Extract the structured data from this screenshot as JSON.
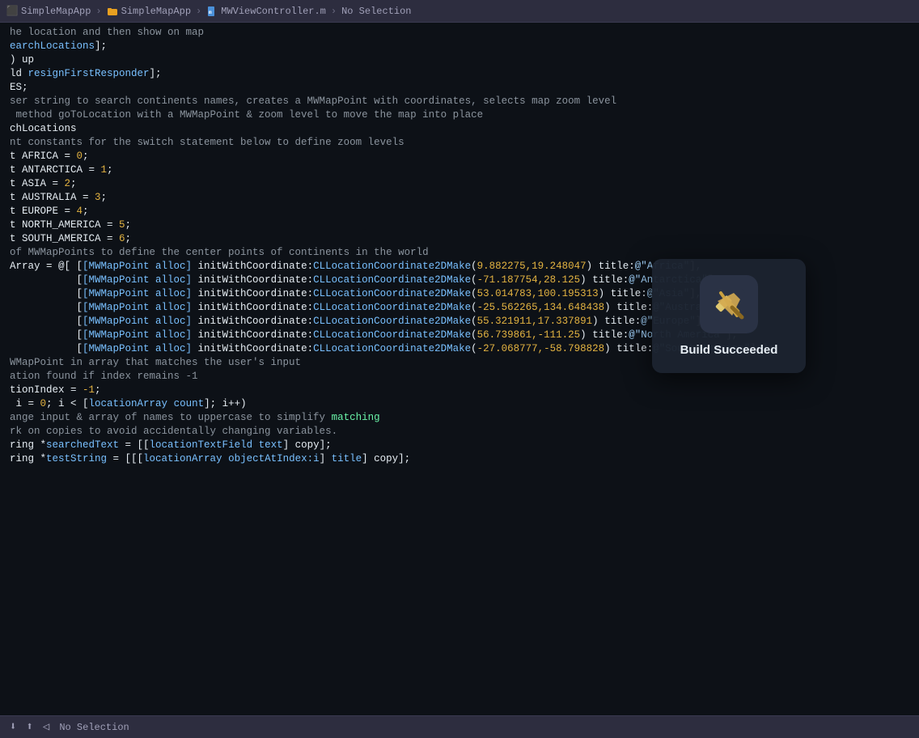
{
  "breadcrumb": {
    "items": [
      {
        "label": "SimpleMapApp",
        "type": "app",
        "icon": "app-icon"
      },
      {
        "label": "SimpleMapApp",
        "type": "folder",
        "icon": "folder-icon"
      },
      {
        "label": "MWViewController.m",
        "type": "file",
        "icon": "file-icon"
      },
      {
        "label": "No Selection",
        "type": "text",
        "icon": null
      }
    ],
    "separator": "›"
  },
  "editor": {
    "lines": [
      {
        "text": "he location and then show on map",
        "class": "c-comment"
      },
      {
        "text": "earchLocations];",
        "class": "c-white"
      },
      {
        "text": "",
        "class": ""
      },
      {
        "text": ") up",
        "class": "c-white"
      },
      {
        "text": "ld resignFirstResponder];",
        "class": "c-white"
      },
      {
        "text": "ES;",
        "class": "c-white"
      },
      {
        "text": "",
        "class": ""
      },
      {
        "text": "ser string to search continents names, creates a MWMapPoint with coordinates, selects map zoom level",
        "class": "c-comment"
      },
      {
        "text": " method goToLocation with a MWMapPoint & zoom level to move the map into place",
        "class": "c-comment"
      },
      {
        "text": "chLocations",
        "class": "c-white"
      },
      {
        "text": "",
        "class": ""
      },
      {
        "text": "nt constants for the switch statement below to define zoom levels",
        "class": "c-comment"
      },
      {
        "text": "t AFRICA = 0;",
        "class": ""
      },
      {
        "text": "t ANTARCTICA = 1;",
        "class": ""
      },
      {
        "text": "t ASIA = 2;",
        "class": ""
      },
      {
        "text": "t AUSTRALIA = 3;",
        "class": ""
      },
      {
        "text": "t EUROPE = 4;",
        "class": ""
      },
      {
        "text": "t NORTH_AMERICA = 5;",
        "class": ""
      },
      {
        "text": "t SOUTH_AMERICA = 6;",
        "class": ""
      },
      {
        "text": "",
        "class": ""
      },
      {
        "text": "of MWMapPoints to define the center points of continents in the world",
        "class": "c-comment"
      },
      {
        "text": "Array = @[ [[MWMapPoint alloc] initWithCoordinate:CLLocationCoordinate2DMake(9.882275,19.248047) title:@\"Africa\"],",
        "class": ""
      },
      {
        "text": "           [[MWMapPoint alloc] initWithCoordinate:CLLocationCoordinate2DMake(-71.187754,28.125) title:@\"Antarctica\"],",
        "class": ""
      },
      {
        "text": "           [[MWMapPoint alloc] initWithCoordinate:CLLocationCoordinate2DMake(53.014783,100.195313) title:@\"Asia\"],",
        "class": ""
      },
      {
        "text": "           [[MWMapPoint alloc] initWithCoordinate:CLLocationCoordinate2DMake(-25.562265,134.648438) title:@\"Australia\"],",
        "class": ""
      },
      {
        "text": "           [[MWMapPoint alloc] initWithCoordinate:CLLocationCoordinate2DMake(55.321911,17.337891) title:@\"Europe\"],",
        "class": ""
      },
      {
        "text": "           [[MWMapPoint alloc] initWithCoordinate:CLLocationCoordinate2DMake(56.739861,-111.25) title:@\"North America\"],",
        "class": ""
      },
      {
        "text": "           [[MWMapPoint alloc] initWithCoordinate:CLLocationCoordinate2DMake(-27.068777,-58.798828) title:@\"South America\"] ];",
        "class": ""
      },
      {
        "text": "",
        "class": ""
      },
      {
        "text": "WMapPoint in array that matches the user's input",
        "class": "c-comment"
      },
      {
        "text": "ation found if index remains -1",
        "class": "c-comment"
      },
      {
        "text": "",
        "class": ""
      },
      {
        "text": "tionIndex = -1;",
        "class": ""
      },
      {
        "text": " i = 0; i < [locationArray count]; i++)",
        "class": ""
      },
      {
        "text": "",
        "class": ""
      },
      {
        "text": "ange input & array of names to uppercase to simplify matching",
        "class": "c-comment"
      },
      {
        "text": "rk on copies to avoid accidentally changing variables.",
        "class": "c-comment"
      },
      {
        "text": "",
        "class": ""
      },
      {
        "text": "ring *searchedText = [[locationTextField text] copy];",
        "class": ""
      },
      {
        "text": "ring *testString = [[[locationArray objectAtIndex:i] title] copy];",
        "class": ""
      }
    ]
  },
  "notification": {
    "title": "Build Succeeded",
    "icon_alt": "hammer-icon"
  },
  "status_bar": {
    "items": [
      "download-icon",
      "upload-icon",
      "location-icon"
    ],
    "selection": "No Selection"
  }
}
